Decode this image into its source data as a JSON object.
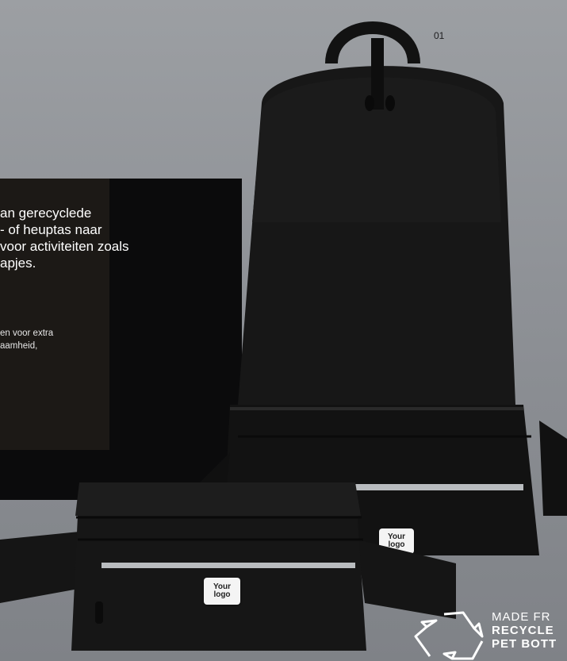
{
  "page": {
    "number": "01"
  },
  "intro": {
    "text": "an gerecyclede\n- of heuptas naar\nvoor activiteiten zoals\napjes."
  },
  "detail": {
    "text": "en voor extra\naamheid,"
  },
  "products": {
    "backpack_logo": "Your\nlogo",
    "waistpack_logo": "Your\nlogo"
  },
  "badge": {
    "line1": "MADE FR",
    "line2": "RECYCLE",
    "line3": "PET BOTT"
  },
  "colors": {
    "background": "#8e9196",
    "panel_dark": "#0b0b0c",
    "panel_brown": "#1c1916",
    "bag": "#141414",
    "reflective_strip": "#b9bcbf"
  }
}
